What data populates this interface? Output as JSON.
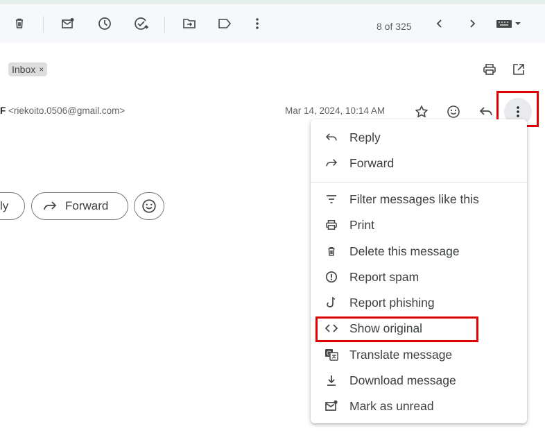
{
  "toolbar": {
    "count": "8 of 325",
    "icons": [
      "delete-icon",
      "mark-unread-icon",
      "snooze-icon",
      "add-task-icon",
      "move-to-icon",
      "label-icon",
      "more-vert-icon",
      "chevron-left-icon",
      "chevron-right-icon",
      "keyboard-icon"
    ]
  },
  "label_chip": {
    "text": "Inbox",
    "remove": "×"
  },
  "header": {
    "sender_truncated": "F",
    "sender_email": "<riekoito.0506@gmail.com>",
    "date": "Mar 14, 2024, 10:14 AM"
  },
  "actions": {
    "reply_truncated": "ly",
    "forward": "Forward"
  },
  "menu": {
    "items": [
      {
        "label": "Reply",
        "icon": "reply-icon"
      },
      {
        "label": "Forward",
        "icon": "forward-icon"
      },
      {
        "label": "Filter messages like this",
        "icon": "filter-icon"
      },
      {
        "label": "Print",
        "icon": "print-icon"
      },
      {
        "label": "Delete this message",
        "icon": "trash-icon"
      },
      {
        "label": "Report spam",
        "icon": "report-spam-icon"
      },
      {
        "label": "Report phishing",
        "icon": "phishing-hook-icon"
      },
      {
        "label": "Show original",
        "icon": "code-icon"
      },
      {
        "label": "Translate message",
        "icon": "translate-icon"
      },
      {
        "label": "Download message",
        "icon": "download-icon"
      },
      {
        "label": "Mark as unread",
        "icon": "mark-unread-icon"
      }
    ]
  },
  "colors": {
    "highlight": "#e00000",
    "toolbar_bg": "#f6f8fb",
    "icon": "#444746"
  }
}
